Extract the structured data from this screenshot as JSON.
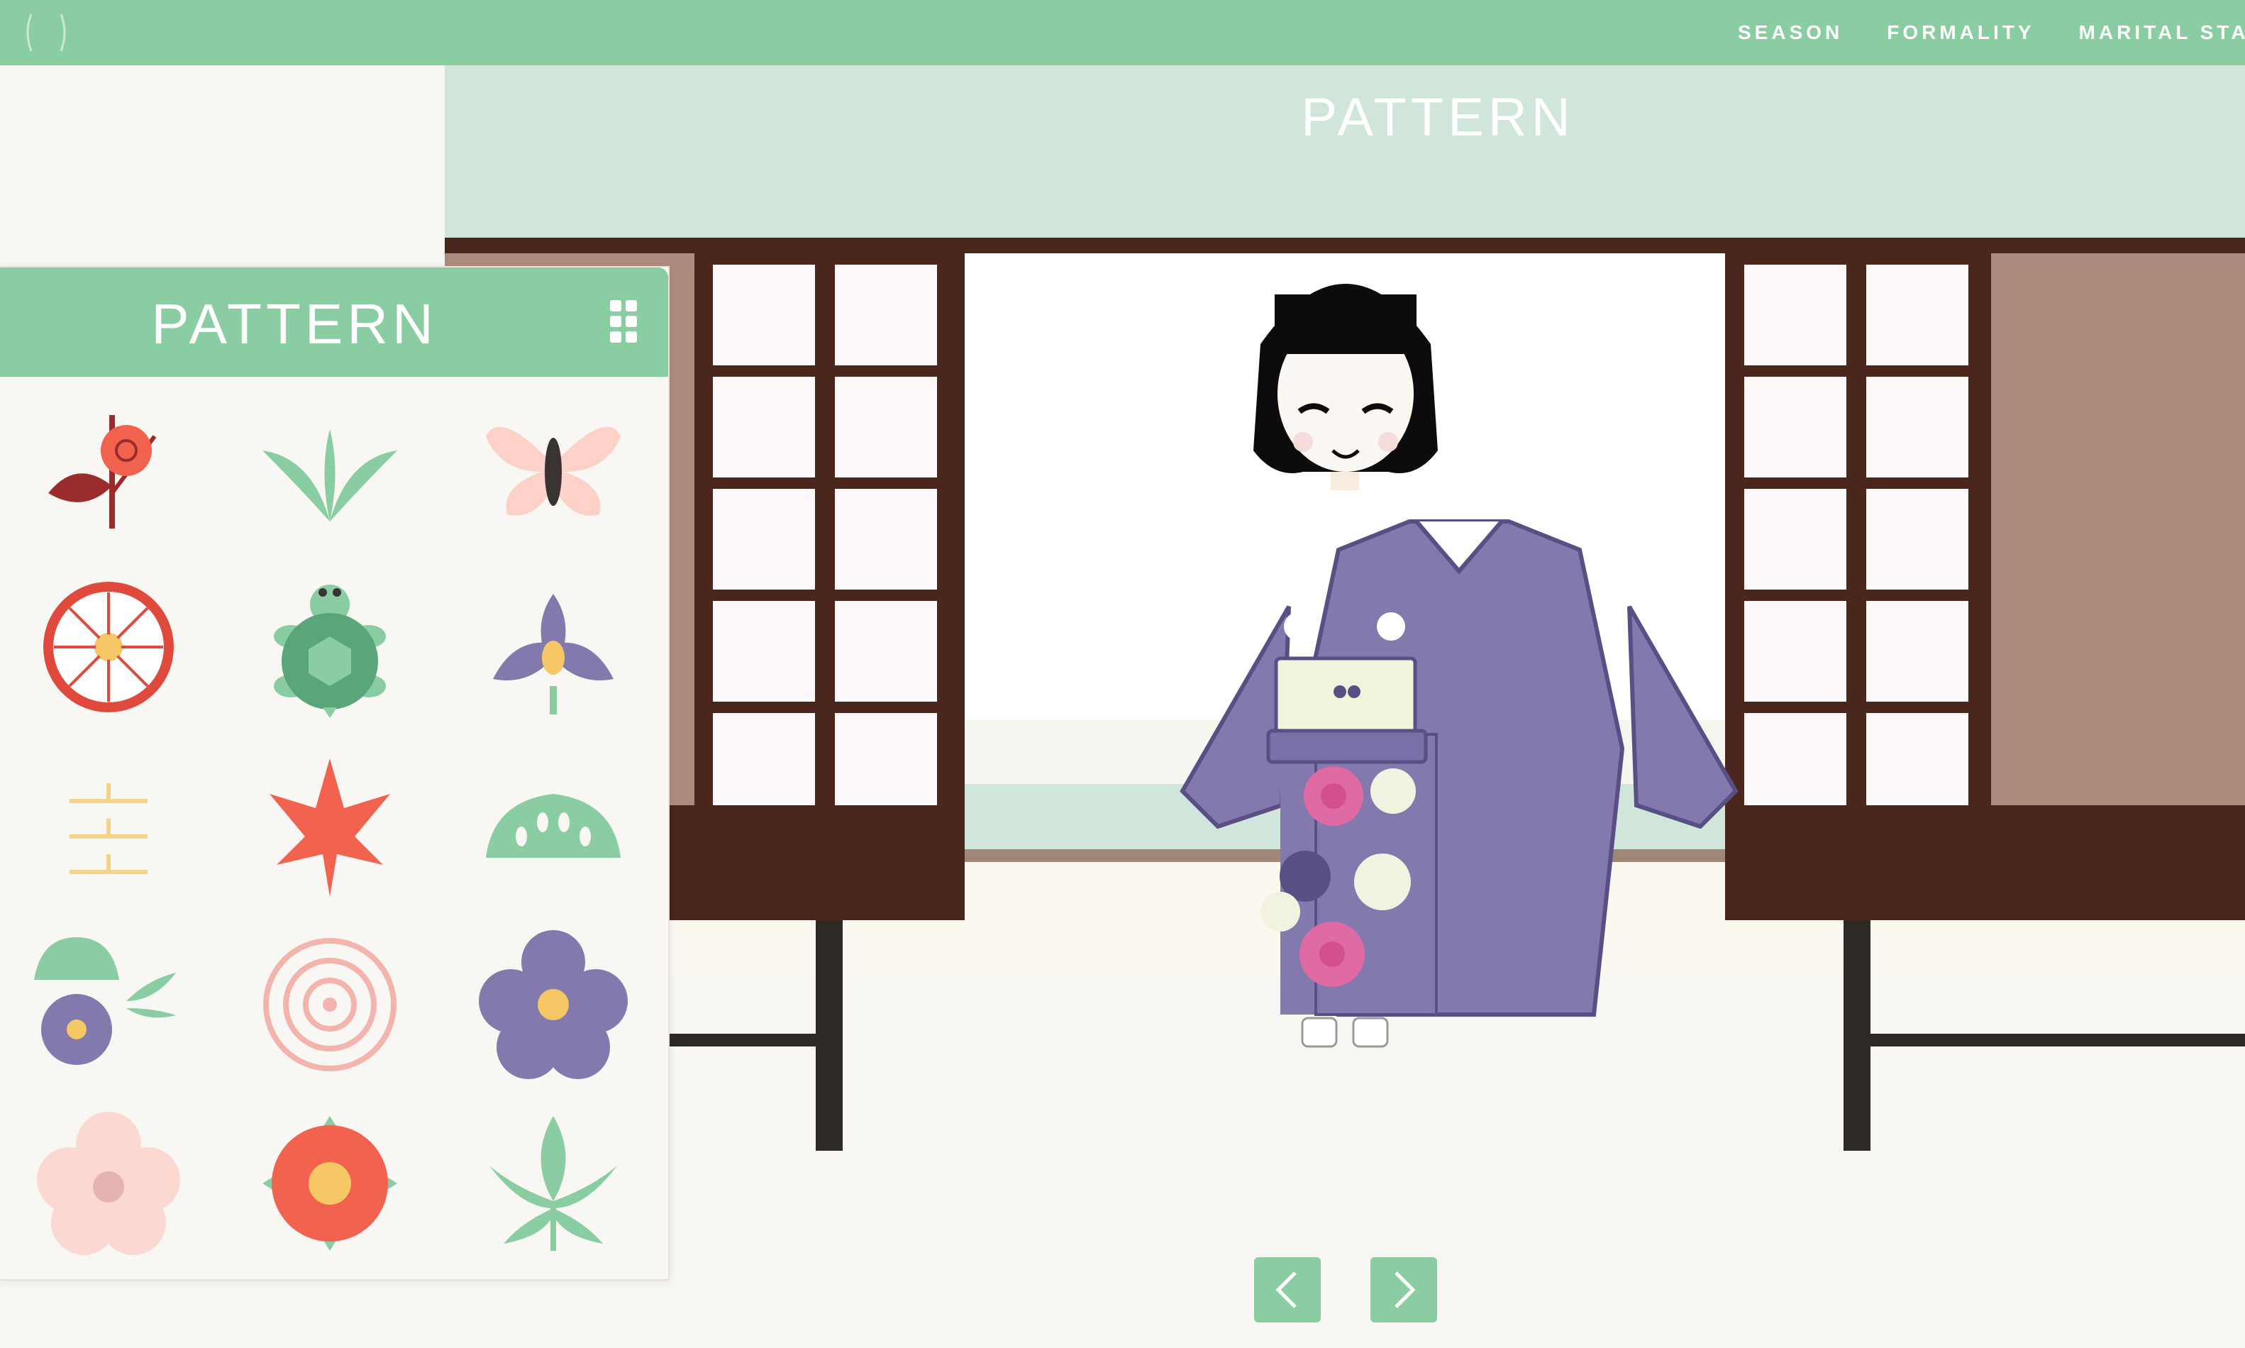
{
  "topbar": {
    "logo_icon": "bracket-logo-icon",
    "nav": [
      "SEASON",
      "FORMALITY",
      "MARITAL STATUS"
    ]
  },
  "stage": {
    "banner_title": "PATTERN",
    "prev_icon": "chevron-left-icon",
    "next_icon": "chevron-right-icon"
  },
  "panel": {
    "title": "PATTERN",
    "menu_icon": "grid-menu-icon",
    "patterns": [
      "plum-blossom-icon",
      "bamboo-leaf-icon",
      "butterfly-icon",
      "chrysanthemum-icon",
      "turtle-icon",
      "iris-icon",
      "mist-icon",
      "maple-leaf-icon",
      "pine-icon",
      "pine-bamboo-plum-icon",
      "peony-icon",
      "bellflower-icon",
      "cherry-blossom-icon",
      "camellia-icon",
      "hemp-leaf-icon"
    ]
  },
  "colors": {
    "accent": "#8acda3",
    "banner": "#d1e6da",
    "wood_dark": "#4a261c",
    "wall": "#ad8a7c",
    "kimono": "#8479ac",
    "obi": "#f1f4dc"
  }
}
